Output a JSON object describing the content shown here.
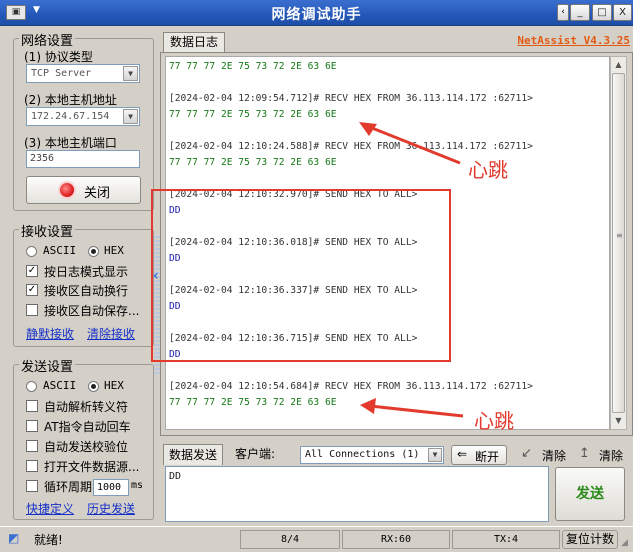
{
  "window": {
    "title": "网络调试助手",
    "brand": "NetAssist V4.3.25",
    "icon": "network-icon",
    "minimize": "_",
    "maximize": "□",
    "close": "X"
  },
  "network": {
    "group_title": "网络设置",
    "protocol_label": "(1) 协议类型",
    "protocol_value": "TCP Server",
    "host_label": "(2) 本地主机地址",
    "host_value": "172.24.67.154",
    "port_label": "(3) 本地主机端口",
    "port_value": "2356",
    "close_button": "关闭",
    "status_color": "#e02020"
  },
  "receive": {
    "group_title": "接收设置",
    "mode_ascii": "ASCII",
    "mode_hex": "HEX",
    "mode_selected": "HEX",
    "option_log_mode": "按日志模式显示",
    "option_auto_wrap": "接收区自动换行",
    "option_save": "接收区自动保存...",
    "link_silent": "静默接收",
    "link_clear": "清除接收"
  },
  "send": {
    "group_title": "发送设置",
    "mode_ascii": "ASCII",
    "mode_hex": "HEX",
    "mode_selected": "HEX",
    "option_escape": "自动解析转义符",
    "option_at": "AT指令自动回车",
    "option_checksum": "自动发送校验位",
    "option_file": "打开文件数据源...",
    "option_loop": "循环周期",
    "loop_value": "1000",
    "loop_unit": "ms",
    "link_shortcut": "快捷定义",
    "link_history": "历史发送"
  },
  "log": {
    "tab_label": "数据日志",
    "lines": [
      {
        "type": "recv",
        "text": "77 77 77 2E 75 73 72 2E 63 6E"
      },
      {
        "type": "hdr",
        "text": "[2024-02-04 12:09:54.712]# RECV HEX FROM 36.113.114.172 :62711>"
      },
      {
        "type": "recv",
        "text": "77 77 77 2E 75 73 72 2E 63 6E"
      },
      {
        "type": "hdr",
        "text": "[2024-02-04 12:10:24.588]# RECV HEX FROM 36.113.114.172 :62711>"
      },
      {
        "type": "recv",
        "text": "77 77 77 2E 75 73 72 2E 63 6E"
      },
      {
        "type": "hdr",
        "text": "[2024-02-04 12:10:32.970]# SEND HEX TO ALL>"
      },
      {
        "type": "send",
        "text": "DD"
      },
      {
        "type": "hdr",
        "text": "[2024-02-04 12:10:36.018]# SEND HEX TO ALL>"
      },
      {
        "type": "send",
        "text": "DD"
      },
      {
        "type": "hdr",
        "text": "[2024-02-04 12:10:36.337]# SEND HEX TO ALL>"
      },
      {
        "type": "send",
        "text": "DD"
      },
      {
        "type": "hdr",
        "text": "[2024-02-04 12:10:36.715]# SEND HEX TO ALL>"
      },
      {
        "type": "send",
        "text": "DD"
      },
      {
        "type": "hdr",
        "text": "[2024-02-04 12:10:54.684]# RECV HEX FROM 36.113.114.172 :62711>"
      },
      {
        "type": "recv",
        "text": "77 77 77 2E 75 73 72 2E 63 6E"
      }
    ]
  },
  "sendbar": {
    "tab_label": "数据发送",
    "client_label": "客户端:",
    "client_value": "All Connections (1)",
    "disconnect": "断开",
    "clear1": "清除",
    "clear2": "清除",
    "input_value": "DD",
    "send_button": "发送"
  },
  "annotations": {
    "heartbeat_top": "心跳",
    "heartbeat_bottom": "心跳",
    "color": "#e23b2e"
  },
  "status": {
    "ready": "就绪!",
    "counter": "8/4",
    "rx": "RX:60",
    "tx": "TX:4",
    "reset": "复位计数"
  }
}
